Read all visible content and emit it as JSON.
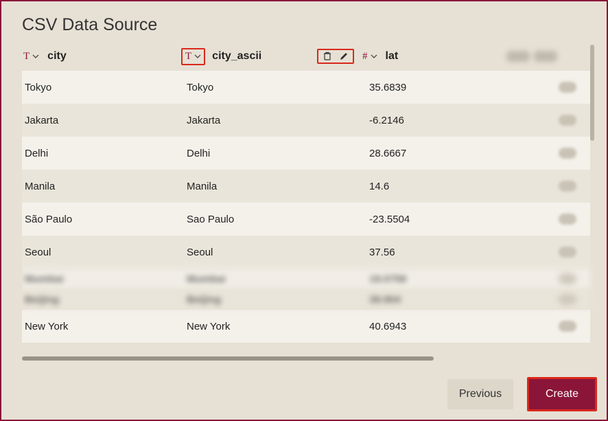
{
  "title": "CSV Data Source",
  "columns": {
    "city": {
      "type": "T",
      "label": "city"
    },
    "city_ascii": {
      "type": "T",
      "label": "city_ascii"
    },
    "lat": {
      "type": "#",
      "label": "lat"
    }
  },
  "rows": [
    {
      "city": "Tokyo",
      "city_ascii": "Tokyo",
      "lat": "35.6839"
    },
    {
      "city": "Jakarta",
      "city_ascii": "Jakarta",
      "lat": "-6.2146"
    },
    {
      "city": "Delhi",
      "city_ascii": "Delhi",
      "lat": "28.6667"
    },
    {
      "city": "Manila",
      "city_ascii": "Manila",
      "lat": "14.6"
    },
    {
      "city": "São Paulo",
      "city_ascii": "Sao Paulo",
      "lat": "-23.5504"
    },
    {
      "city": "Seoul",
      "city_ascii": "Seoul",
      "lat": "37.56"
    }
  ],
  "blurred_rows": [
    {
      "city": "Mumbai",
      "city_ascii": "Mumbai",
      "lat": "19.0758"
    },
    {
      "city": "Beijing",
      "city_ascii": "Beijing",
      "lat": "39.904"
    }
  ],
  "tail_row": {
    "city": "New York",
    "city_ascii": "New York",
    "lat": "40.6943"
  },
  "buttons": {
    "previous": "Previous",
    "create": "Create"
  }
}
